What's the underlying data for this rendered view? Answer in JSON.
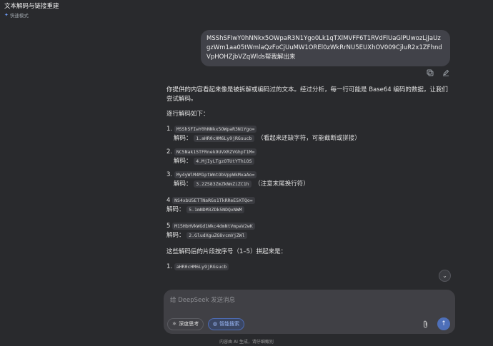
{
  "header": {
    "title": "文本解码与链接重建",
    "mode_label": "快速模式",
    "mode_icon": "sparkle-icon"
  },
  "user_message": {
    "text": "MSShSFIwY0hNNkx5OWpaR3N1Ygo0Lk1qTXlMVFF6T1RVdFlUaGlPUwozLjJaUzgzWm1aa05tWmlaQzFoCjUuMW1OREl0zWkRrNU5EUXhOV009CjluR2x1ZFhndVpHOHZjbVZqWlds帮我解出来"
  },
  "actions": {
    "copy_icon": "copy-icon",
    "edit_icon": "edit-icon"
  },
  "answer": {
    "intro": "你提供的内容看起来像是被拆解或编码过的文本。经过分析，每一行可能是 Base64 编码的数据，让我们尝试解码。",
    "step_heading": "逐行解码如下：",
    "decode_label": "解码：",
    "items": [
      {
        "num": "1.",
        "code": "MSShSFIwY0hNNkx5OWpaR3N1Ygo=",
        "decoded": "1.aHR0cHM6Ly9jRGsucb",
        "note": "（看起来还缺字符，可能截断或拼接）"
      },
      {
        "num": "2.",
        "code": "NC5Nak15TFRnek9UVXRZVGhpT1M=",
        "decoded": "4.MjIyLTgzOTUtYThiOS",
        "note": ""
      },
      {
        "num": "3.",
        "code": "My4yWlM4M1ptWmtObVppWkMxaAo=",
        "decoded": "3.2ZS83ZmZkNmZiZC1h",
        "note": "（注意末尾换行符）"
      },
      {
        "num": "4",
        "code": "NS4xbU5ETTNaRGs1TkRReE5XTQo=",
        "decoded": "5.1mNDM3ZDk5NDQxNWM",
        "note": ""
      },
      {
        "num": "5",
        "code": "M15HbHVkWGd1Wkc4dmNtVmpaV2wK",
        "decoded": "2.GludXguZG8vcmVjZWl",
        "note": ""
      }
    ],
    "order_heading": "这些解码后的片段按序号（1–5）拼起来是：",
    "ordered": [
      {
        "num": "1.",
        "code": "aHR0cHM6Ly9jRGsucb"
      }
    ]
  },
  "composer": {
    "placeholder": "给 DeepSeek 发送消息",
    "deep_think_label": "深度思考",
    "search_label": "智能搜索",
    "deep_icon": "atom-icon",
    "search_icon": "globe-icon",
    "attach_icon": "paperclip-icon",
    "send_icon": "arrow-up-icon"
  },
  "footer": {
    "disclaimer": "内容由 AI 生成，请仔细甄别"
  },
  "scroll_icon": "chevron-down-icon"
}
